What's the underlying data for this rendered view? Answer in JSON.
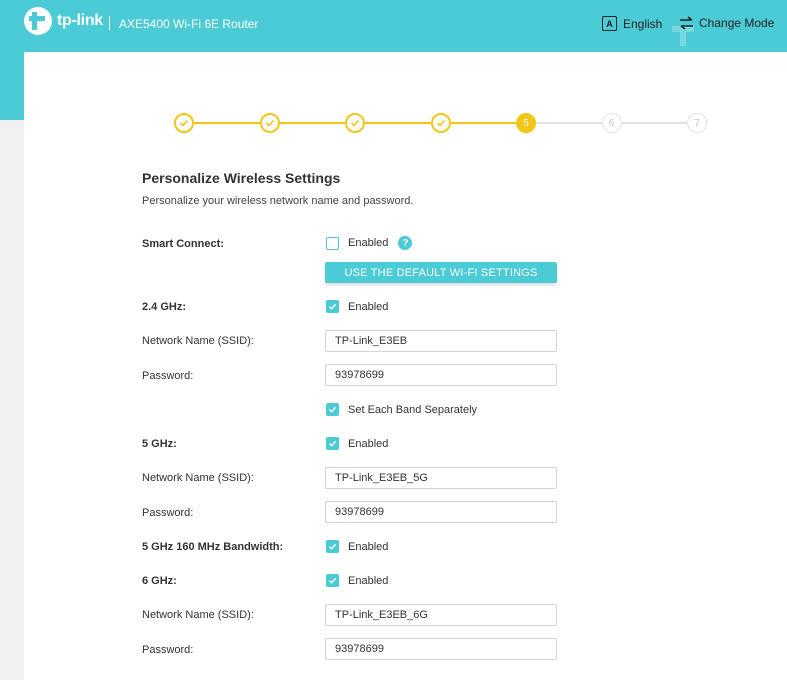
{
  "header": {
    "logo_text": "tp-link",
    "product_title": "AXE5400 Wi-Fi 6E Router",
    "language_icon_glyph": "A",
    "language_label": "English",
    "change_mode_label": "Change Mode"
  },
  "colors": {
    "accent": "#4acbd6",
    "step_done": "#f5c518",
    "step_todo": "#e2e2e2"
  },
  "stepper": {
    "current_step": 5,
    "steps": [
      {
        "label": "1",
        "state": "done"
      },
      {
        "label": "2",
        "state": "done"
      },
      {
        "label": "3",
        "state": "done"
      },
      {
        "label": "4",
        "state": "done"
      },
      {
        "label": "5",
        "state": "current"
      },
      {
        "label": "6",
        "state": "todo"
      },
      {
        "label": "7",
        "state": "todo"
      }
    ]
  },
  "page": {
    "title": "Personalize Wireless Settings",
    "description": "Personalize your wireless network name and password."
  },
  "form": {
    "smart_connect": {
      "label": "Smart Connect:",
      "checkbox_label": "Enabled",
      "checked": false,
      "help_glyph": "?"
    },
    "default_button": "USE THE DEFAULT WI-FI SETTINGS",
    "band_24": {
      "label": "2.4 GHz:",
      "checkbox_label": "Enabled",
      "checked": true,
      "ssid_label": "Network Name (SSID):",
      "ssid_value": "TP-Link_E3EB",
      "password_label": "Password:",
      "password_value": "93978699"
    },
    "separate": {
      "checkbox_label": "Set Each Band Separately",
      "checked": true
    },
    "band_5": {
      "label": "5 GHz:",
      "checkbox_label": "Enabled",
      "checked": true,
      "ssid_label": "Network Name (SSID):",
      "ssid_value": "TP-Link_E3EB_5G",
      "password_label": "Password:",
      "password_value": "93978699"
    },
    "bandwidth_160": {
      "label": "5 GHz 160 MHz Bandwidth:",
      "checkbox_label": "Enabled",
      "checked": true
    },
    "band_6": {
      "label": "6 GHz:",
      "checkbox_label": "Enabled",
      "checked": true,
      "ssid_label": "Network Name (SSID):",
      "ssid_value": "TP-Link_E3EB_6G",
      "password_label": "Password:",
      "password_value": "93978699"
    }
  }
}
